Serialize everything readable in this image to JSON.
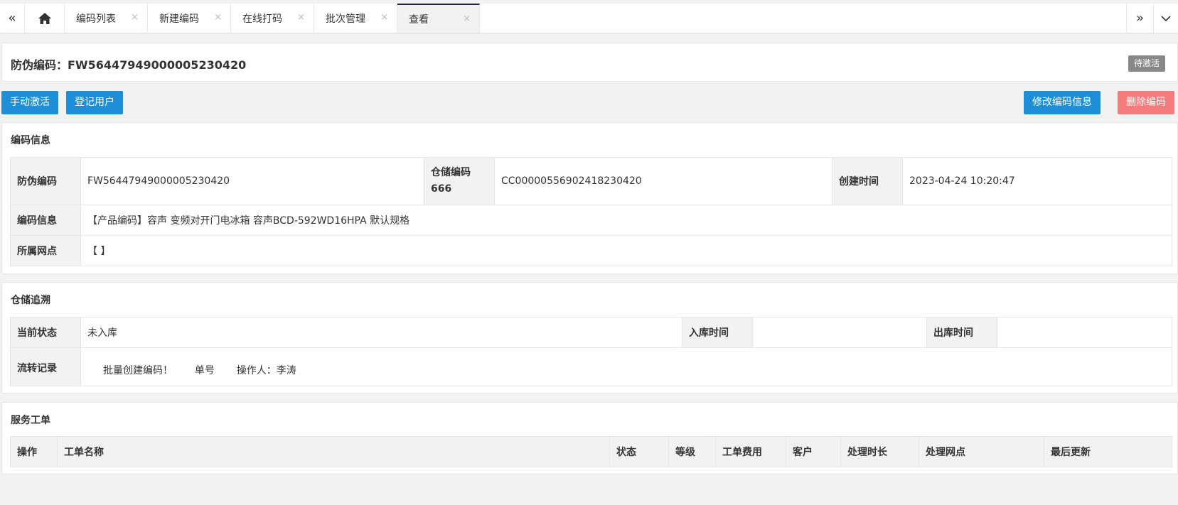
{
  "tabs": {
    "home_icon": "home-icon",
    "items": [
      {
        "label": "编码列表"
      },
      {
        "label": "新建编码"
      },
      {
        "label": "在线打码"
      },
      {
        "label": "批次管理"
      },
      {
        "label": "查看"
      }
    ],
    "close_glyph": "×",
    "nav_left_glyph": "«",
    "nav_right_glyph": "»",
    "nav_down_glyph": "⌄",
    "active_color": "#1c2a4a"
  },
  "header": {
    "title": "防伪编码：FW56447949000005230420",
    "status": "待激活"
  },
  "actions": {
    "activate": "手动激活",
    "register_user": "登记用户",
    "edit_info": "修改编码信息",
    "delete_code": "删除编码",
    "primary_color": "#1e8fd6",
    "danger_color": "#f47c7c"
  },
  "code_info": {
    "title": "编码信息",
    "anti_fake_label": "防伪编码",
    "anti_fake_value": "FW56447949000005230420",
    "storage_label_line1": "仓储编码",
    "storage_label_line2": "666",
    "storage_value": "CC00000556902418230420",
    "created_label": "创建时间",
    "created_value": "2023-04-24 10:20:47",
    "info_label": "编码信息",
    "info_value": "【产品编码】容声 变频对开门电冰箱 容声BCD-592WD16HPA 默认规格",
    "outlet_label": "所属网点",
    "outlet_value": "【 】"
  },
  "storage_trace": {
    "title": "仓储追溯",
    "status_label": "当前状态",
    "status_value": "未入库",
    "in_label": "入库时间",
    "in_value": "",
    "out_label": "出库时间",
    "out_value": "",
    "flow_label": "流转记录",
    "flow_action": "批量创建编码！",
    "flow_order": "单号",
    "flow_operator": "操作人：李涛"
  },
  "service_orders": {
    "title": "服务工单",
    "columns": [
      "操作",
      "工单名称",
      "状态",
      "等级",
      "工单费用",
      "客户",
      "处理时长",
      "处理网点",
      "最后更新"
    ]
  }
}
